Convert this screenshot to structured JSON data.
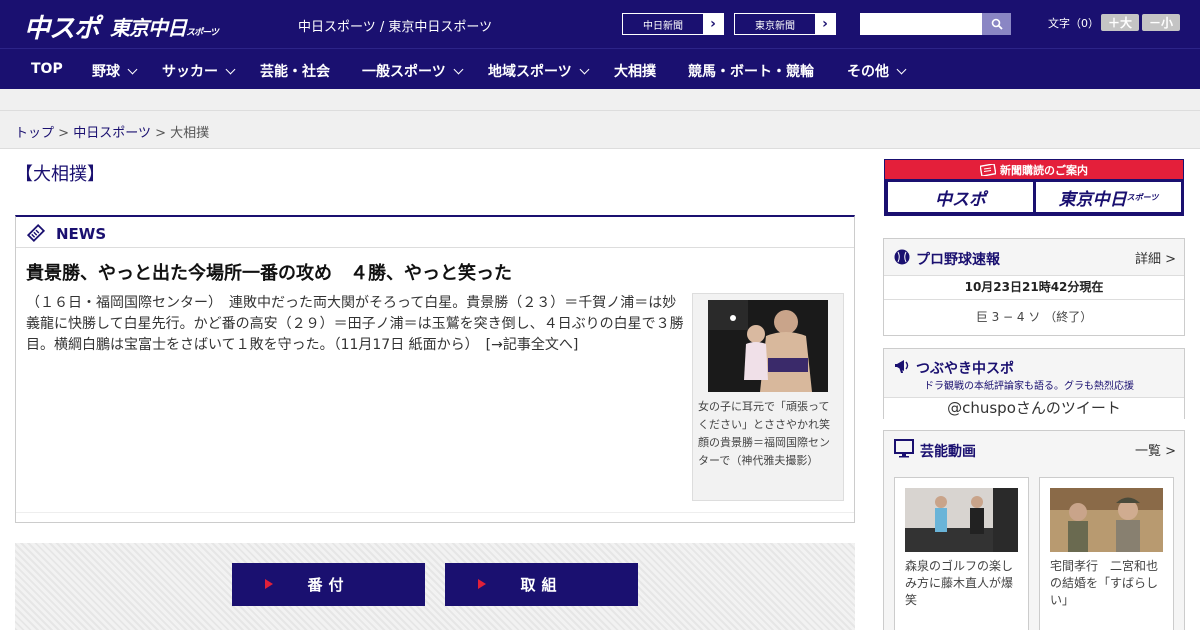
{
  "header": {
    "logo_main": "中スポ",
    "logo_tokyo": "東京中日",
    "logo_tokyo_sub": "スポーツ",
    "site_names": "中日スポーツ / 東京中日スポーツ",
    "ext_links": [
      {
        "label": "中日新聞",
        "arrow": "›"
      },
      {
        "label": "東京新聞",
        "arrow": "›"
      }
    ],
    "search": {
      "placeholder": "",
      "value": ""
    },
    "font_size_label": "文字（0）",
    "font_plus": "＋大",
    "font_minus": "－小"
  },
  "nav": {
    "items": [
      {
        "label": "TOP"
      },
      {
        "label": "野球"
      },
      {
        "label": "サッカー"
      },
      {
        "label": "芸能・社会"
      },
      {
        "label": "一般スポーツ"
      },
      {
        "label": "地域スポーツ"
      },
      {
        "label": "大相撲"
      },
      {
        "label": "競馬・ボート・競輪"
      },
      {
        "label": "その他"
      }
    ]
  },
  "breadcrumb": {
    "home": "トップ",
    "sep": ">",
    "parent": "中日スポーツ",
    "current": "大相撲"
  },
  "page": {
    "title": "【大相撲】"
  },
  "news": {
    "label": "NEWS",
    "headline": "貴景勝、やっと出た今場所一番の攻め　４勝、やっと笑った",
    "body": "（１６日・福岡国際センター）　連敗中だった両大関がそろって白星。貴景勝（２３）＝千賀ノ浦＝は妙義龍に快勝して白星先行。かど番の高安（２９）＝田子ノ浦＝は玉鷲を突き倒し、４日ぶりの白星で３勝目。横綱白鵬は宝富士をさばいて１敗を守った。（11月17日 紙面から）　[→記事全文へ]",
    "photo_caption": "女の子に耳元で「頑張ってください」とささやかれ笑顔の貴景勝＝福岡国際センターで（神代雅夫撮影）"
  },
  "buttons": {
    "banzuke": "番付",
    "torikumi": "取組"
  },
  "sidebar": {
    "subscribe": {
      "label": "新聞購読のご案内",
      "logo_left": "中スポ",
      "logo_right": "東京中日",
      "logo_right_sub": "スポーツ"
    },
    "baseball": {
      "title": "プロ野球速報",
      "more": "詳細 >",
      "updated": "10月23日21時42分現在",
      "score": "巨 3 − 4 ソ （終了）"
    },
    "twitter": {
      "title": "つぶやき中スポ",
      "subtitle": "ドラ観戦の本紙評論家も語る。グラも熱烈応援",
      "link": "@chuspoさんのツイート"
    },
    "video": {
      "title": "芸能動画",
      "more": "一覧 >",
      "items": [
        {
          "caption": "森泉のゴルフの楽しみ方に藤木直人が爆笑"
        },
        {
          "caption": "宅間孝行　二宮和也の結婚を「すばらしい」"
        }
      ]
    }
  },
  "colors": {
    "brand": "#1a1070",
    "accent_red": "#e41f3a"
  }
}
